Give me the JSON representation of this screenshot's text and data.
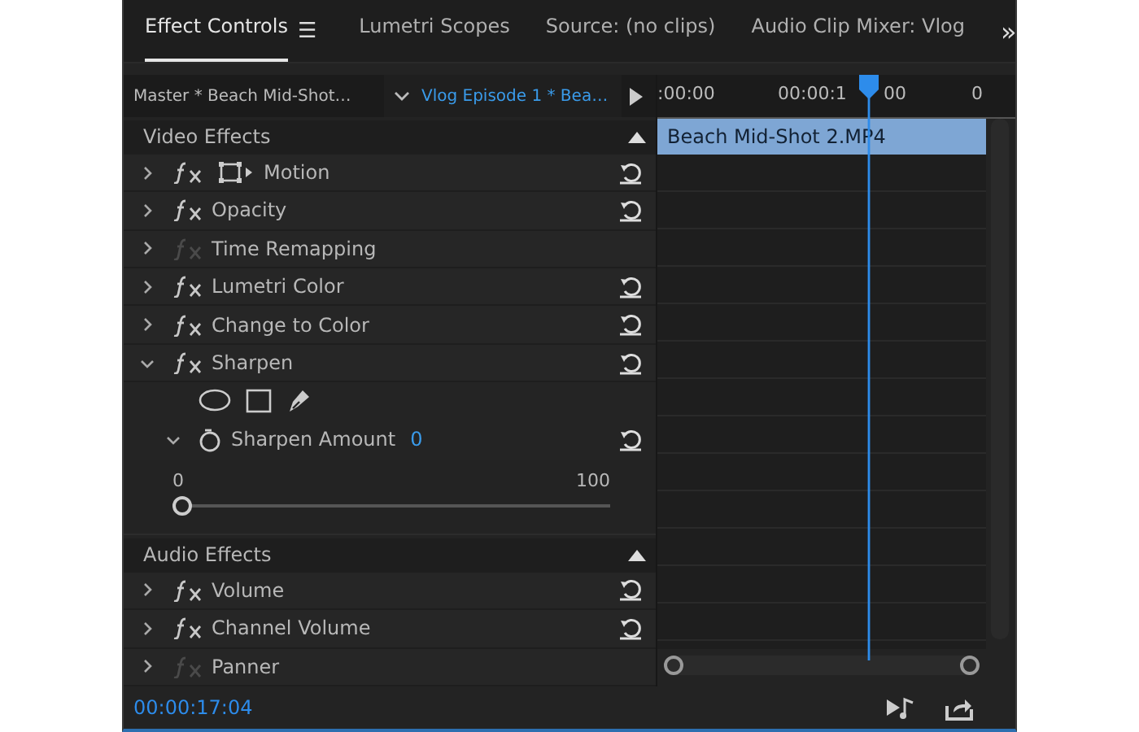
{
  "tabs": [
    {
      "label": "Effect Controls",
      "selected": true,
      "menu": "☰"
    },
    {
      "label": "Lumetri Scopes",
      "selected": false
    },
    {
      "label": "Source: (no clips)",
      "selected": false
    },
    {
      "label": "Audio Clip Mixer: Vlog",
      "selected": false
    }
  ],
  "overflow": "»",
  "source_bar": {
    "master": "Master * Beach Mid-Shot…",
    "sequence": "Vlog Episode 1 * Bea…"
  },
  "sections": [
    {
      "title": "Video Effects",
      "effects": [
        {
          "name": "Motion",
          "kind": "motion",
          "expanded": false,
          "enabled": true,
          "resettable": true
        },
        {
          "name": "Opacity",
          "kind": "effect",
          "expanded": false,
          "enabled": true,
          "resettable": true
        },
        {
          "name": "Time Remapping",
          "kind": "effect",
          "expanded": false,
          "enabled": false,
          "resettable": false
        },
        {
          "name": "Lumetri Color",
          "kind": "effect",
          "expanded": false,
          "enabled": true,
          "resettable": true
        },
        {
          "name": "Change to Color",
          "kind": "effect",
          "expanded": false,
          "enabled": true,
          "resettable": true
        },
        {
          "name": "Sharpen",
          "kind": "effect",
          "expanded": true,
          "enabled": true,
          "resettable": true,
          "parameter": {
            "name": "Sharpen Amount",
            "value": "0",
            "expanded": true,
            "min_label": "0",
            "max_label": "100",
            "level": 0
          }
        }
      ]
    },
    {
      "title": "Audio Effects",
      "effects": [
        {
          "name": "Volume",
          "kind": "effect",
          "expanded": false,
          "enabled": true,
          "resettable": true
        },
        {
          "name": "Channel Volume",
          "kind": "effect",
          "expanded": false,
          "enabled": true,
          "resettable": true
        },
        {
          "name": "Panner",
          "kind": "effect",
          "expanded": false,
          "enabled": false,
          "resettable": false
        }
      ]
    }
  ],
  "timeline": {
    "ruler": [
      ":00:00",
      "00:00:1",
      "00",
      "0"
    ],
    "clip": "Beach Mid-Shot 2.MP4"
  },
  "timecode": "00:00:17:04"
}
